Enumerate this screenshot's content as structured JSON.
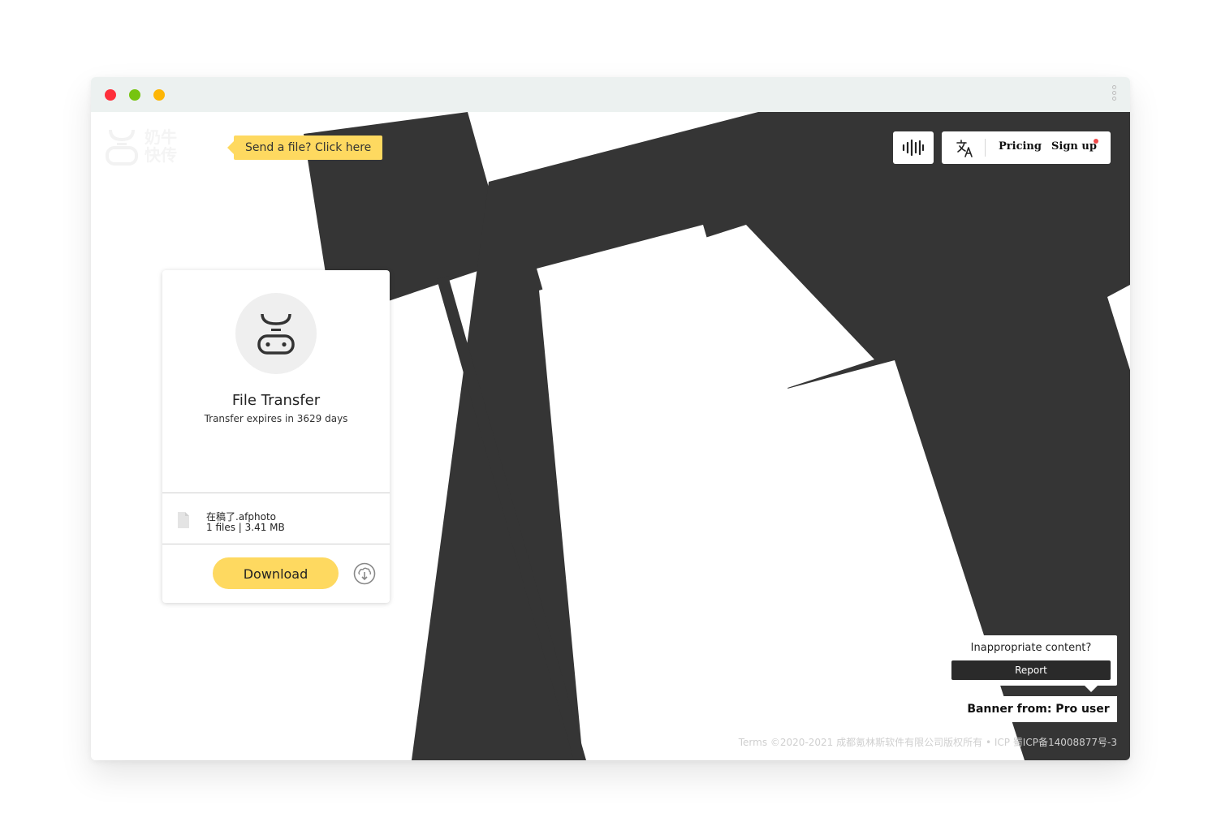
{
  "window": {
    "controls": [
      "close",
      "minimize",
      "zoom"
    ],
    "menu_icon": "kebab-menu-icon"
  },
  "header": {
    "logo_text_line1": "奶牛",
    "logo_text_line2": "快传",
    "send_tip": "Send a file? Click here",
    "sound_icon": "sound-wave-icon",
    "translate_icon": "translate-icon",
    "pricing_label": "Pricing",
    "signup_label": "Sign up"
  },
  "card": {
    "title": "File Transfer",
    "subtitle": "Transfer expires in 3629 days",
    "file": {
      "name": "在稿了.afphoto",
      "meta": "1 files | 3.41 MB"
    },
    "download_label": "Download"
  },
  "report": {
    "question": "Inappropriate content?",
    "button_label": "Report"
  },
  "banner_from": "Banner from: Pro user",
  "footer": "Terms ©2020-2021 成都氪林斯软件有限公司版权所有 • ICP 蜀ICP备14008877号-3",
  "colors": {
    "accent": "#fed960",
    "art_dark": "#353535",
    "titlebar": "#ecf1f0"
  }
}
